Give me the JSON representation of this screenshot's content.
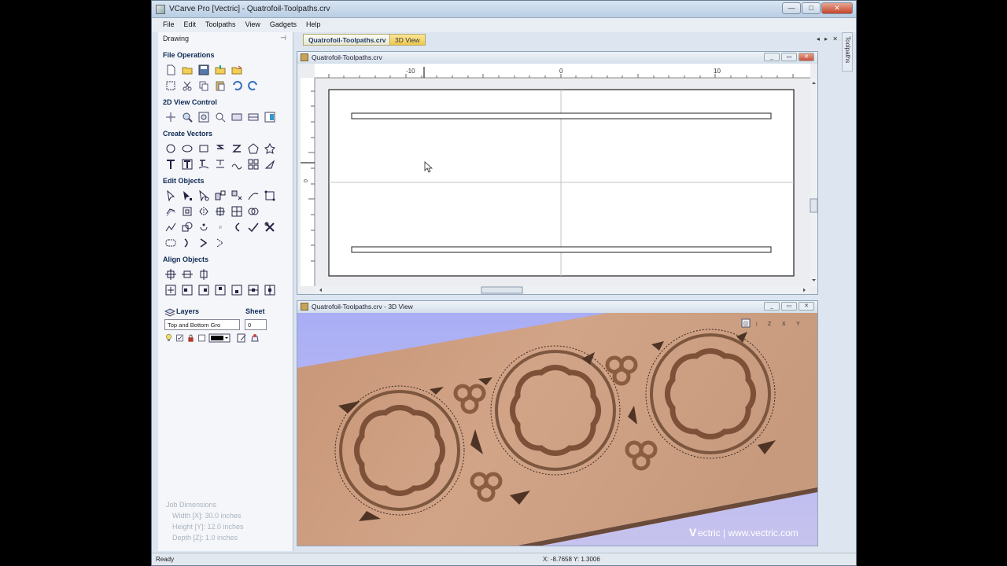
{
  "window": {
    "title": "VCarve Pro [Vectric] - Quatrofoil-Toolpaths.crv",
    "min": "—",
    "max": "□",
    "close": "✕"
  },
  "menu": [
    "File",
    "Edit",
    "Toolpaths",
    "View",
    "Gadgets",
    "Help"
  ],
  "left_panel": {
    "title": "Drawing",
    "pin": "⊣",
    "sections": {
      "file_operations": "File Operations",
      "view_control": "2D View Control",
      "create_vectors": "Create Vectors",
      "edit_objects": "Edit Objects",
      "align_objects": "Align Objects"
    },
    "layers_label": "Layers",
    "sheet_label": "Sheet",
    "layer_value": "Top and Bottom Gro",
    "sheet_value": "0",
    "job_dimensions": {
      "title": "Job Dimensions",
      "width": "Width  [X]: 30.0 inches",
      "height": "Height [Y]: 12.0 inches",
      "depth": "Depth  [Z]: 1.0 inches"
    }
  },
  "tabs": {
    "active": "Quatrofoil-Toolpaths.crv",
    "inactive": "3D View",
    "controls": "◂ ▸ ✕"
  },
  "right_strip": "Toolpaths",
  "view2d": {
    "title": "Quatrofoil-Toolpaths.crv",
    "ruler_labels": [
      "-10",
      "0",
      "10"
    ],
    "vruler_label": "0"
  },
  "view3d": {
    "title": "Quatrofoil-Toolpaths.crv - 3D View",
    "toolbar": [
      "⊡",
      "↕",
      "Z",
      "X",
      "Y"
    ],
    "watermark_v": "V",
    "watermark": "ectric  |  www.vectric.com"
  },
  "status": {
    "left": "Ready",
    "coords": "X: -8.7658 Y: 1.3006"
  },
  "colors": {
    "accent": "#f0c84a",
    "wood": "#c9987a",
    "bg3d": "#b4b6f2"
  }
}
